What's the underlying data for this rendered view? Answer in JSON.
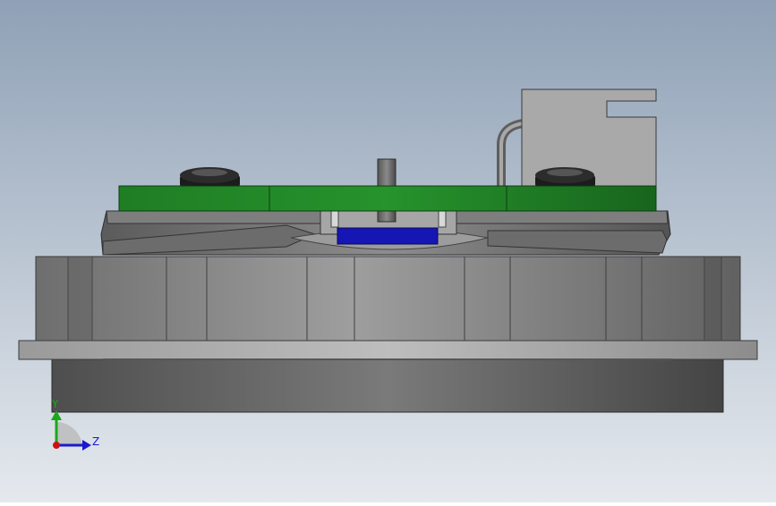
{
  "viewport": {
    "background_top": "#8fa1b6",
    "background_bottom": "#e5e9ee"
  },
  "model": {
    "pcb_color": "#1d8a24",
    "sensor_color": "#1616b4",
    "part_gray": "#8c8c8c"
  },
  "triad": {
    "axis_y_label": "Y",
    "axis_z_label": "Z",
    "y_color": "#1aa81a",
    "z_color": "#1a1acc",
    "origin_color": "#d01010"
  }
}
